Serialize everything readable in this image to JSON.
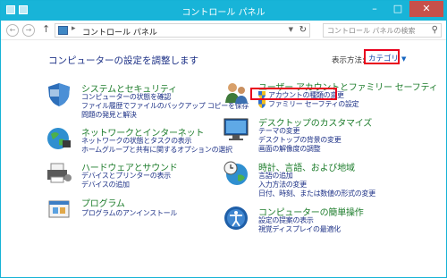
{
  "window": {
    "title": "コントロール パネル"
  },
  "nav": {
    "back_icon": "back-arrow-icon",
    "forward_icon": "forward-arrow-icon",
    "up_icon": "up-arrow-icon",
    "breadcrumb": "コントロール パネル",
    "search_placeholder": "コントロール パネルの検索"
  },
  "main": {
    "heading": "コンピューターの設定を調整します",
    "view_by_label": "表示方法:",
    "view_by_value": "カテゴリ"
  },
  "categories_left": [
    {
      "title": "システムとセキュリティ",
      "links": [
        "コンピューターの状態を確認",
        "ファイル履歴でファイルのバックアップ コピーを保存",
        "問題の発見と解決"
      ]
    },
    {
      "title": "ネットワークとインターネット",
      "links": [
        "ネットワークの状態とタスクの表示",
        "ホームグループと共有に関するオプションの選択"
      ]
    },
    {
      "title": "ハードウェアとサウンド",
      "links": [
        "デバイスとプリンターの表示",
        "デバイスの追加"
      ]
    },
    {
      "title": "プログラム",
      "links": [
        "プログラムのアンインストール"
      ]
    }
  ],
  "categories_right": [
    {
      "title": "ユーザー アカウントとファミリー セーフティ",
      "links": [
        "アカウントの種類の変更",
        "ファミリー セーフティの設定"
      ]
    },
    {
      "title": "デスクトップのカスタマイズ",
      "links": [
        "テーマの変更",
        "デスクトップの背景の変更",
        "画面の解像度の調整"
      ]
    },
    {
      "title": "時計、言語、および地域",
      "links": [
        "言語の追加",
        "入力方法の変更",
        "日付、時刻、または数値の形式の変更"
      ]
    },
    {
      "title": "コンピューターの簡単操作",
      "links": [
        "設定の提案の表示",
        "視覚ディスプレイの最適化"
      ]
    }
  ]
}
